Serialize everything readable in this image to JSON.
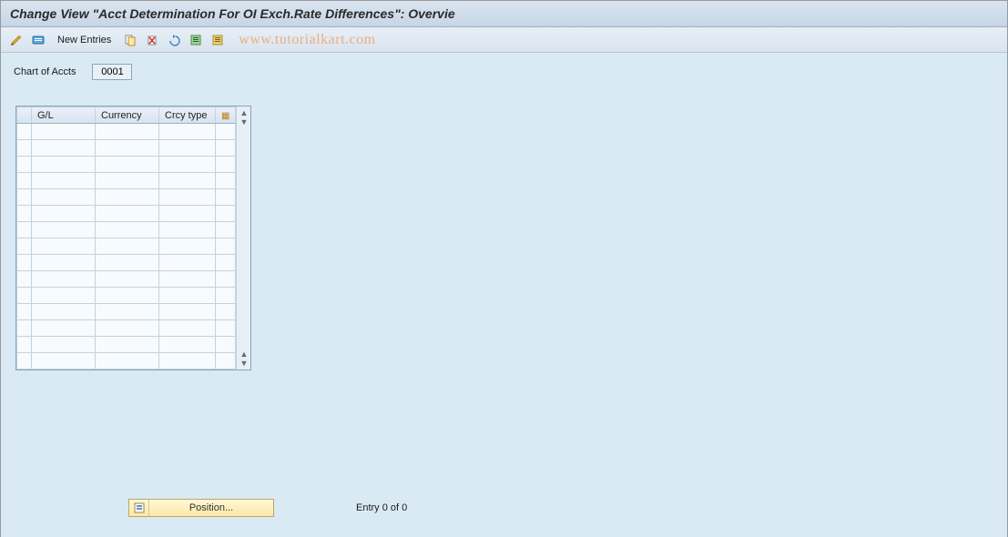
{
  "title": "Change View \"Acct Determination For OI Exch.Rate Differences\": Overvie",
  "toolbar": {
    "new_entries_label": "New Entries"
  },
  "watermark": "www.tutorialkart.com",
  "chart_of_accts": {
    "label": "Chart of Accts",
    "value": "0001"
  },
  "grid": {
    "columns": [
      "G/L",
      "Currency",
      "Crcy type"
    ],
    "rows": [
      {
        "gl": "",
        "currency": "",
        "ctype": ""
      },
      {
        "gl": "",
        "currency": "",
        "ctype": ""
      },
      {
        "gl": "",
        "currency": "",
        "ctype": ""
      },
      {
        "gl": "",
        "currency": "",
        "ctype": ""
      },
      {
        "gl": "",
        "currency": "",
        "ctype": ""
      },
      {
        "gl": "",
        "currency": "",
        "ctype": ""
      },
      {
        "gl": "",
        "currency": "",
        "ctype": ""
      },
      {
        "gl": "",
        "currency": "",
        "ctype": ""
      },
      {
        "gl": "",
        "currency": "",
        "ctype": ""
      },
      {
        "gl": "",
        "currency": "",
        "ctype": ""
      },
      {
        "gl": "",
        "currency": "",
        "ctype": ""
      },
      {
        "gl": "",
        "currency": "",
        "ctype": ""
      },
      {
        "gl": "",
        "currency": "",
        "ctype": ""
      },
      {
        "gl": "",
        "currency": "",
        "ctype": ""
      },
      {
        "gl": "",
        "currency": "",
        "ctype": ""
      }
    ]
  },
  "position_button": "Position...",
  "entry_status": "Entry 0 of 0"
}
